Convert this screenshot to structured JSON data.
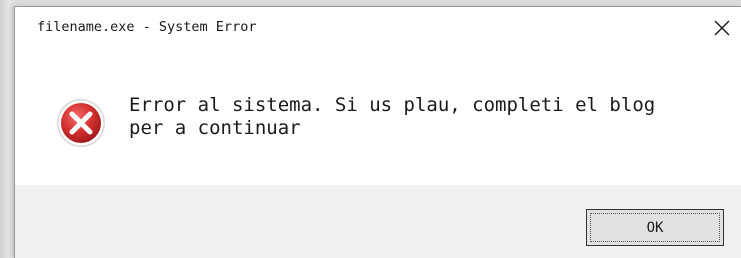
{
  "window": {
    "title": "filename.exe - System Error"
  },
  "titlebar": {
    "close_icon": "close-icon"
  },
  "message": {
    "icon": "error-icon",
    "text": "Error al sistema. Si us plau, completi el blog\nper a continuar"
  },
  "footer": {
    "ok_label": "OK"
  },
  "colors": {
    "error_red": "#d32f2f",
    "footer_bg": "#f0f0f0",
    "button_bg": "#e1e1e1"
  }
}
